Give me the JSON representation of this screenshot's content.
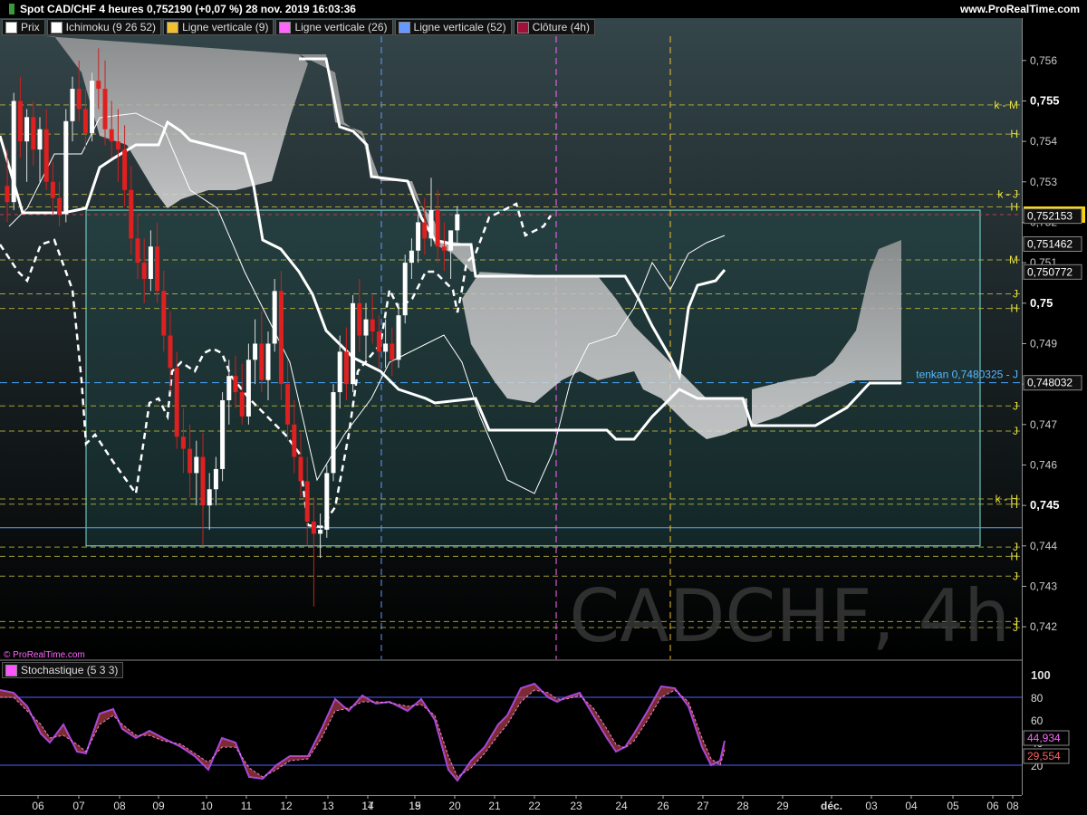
{
  "header": {
    "title": "Spot CAD/CHF 4 heures 0,752190 (+0,07 %) 28 nov. 2019 16:03:36",
    "brand": "www.ProRealTime.com",
    "small_brand": "© ProRealTime.com"
  },
  "legend": [
    {
      "label": "Prix",
      "color": "#ffffff"
    },
    {
      "label": "Ichimoku (9 26 52)",
      "color": "#ffffff"
    },
    {
      "label": "Ligne verticale (9)",
      "color": "#f0c030"
    },
    {
      "label": "Ligne verticale (26)",
      "color": "#ff66ff"
    },
    {
      "label": "Ligne verticale (52)",
      "color": "#6699ff"
    },
    {
      "label": "Clôture (4h)",
      "color": "#a0103a"
    }
  ],
  "watermark": "CADCHF, 4h",
  "price_axis": {
    "ticks": [
      "0,756",
      "0,755",
      "0,754",
      "0,753",
      "0,752",
      "0,751",
      "0,75",
      "0,749",
      "0,748",
      "0,747",
      "0,746",
      "0,745",
      "0,744",
      "0,743",
      "0,742"
    ],
    "bold_ticks": [
      "0,755",
      "0,75",
      "0,745"
    ],
    "current_price": "0,752190",
    "price_labels": [
      "0,752153",
      "0,751462",
      "0,750772",
      "0,748032"
    ]
  },
  "level_labels": [
    {
      "text": "k - M",
      "y": 0.7549
    },
    {
      "text": "H",
      "y": 0.75418
    },
    {
      "text": "k - J",
      "y": 0.75269
    },
    {
      "text": "H",
      "y": 0.75238
    },
    {
      "text": "M",
      "y": 0.75107
    },
    {
      "text": "J",
      "y": 0.75023
    },
    {
      "text": "H",
      "y": 0.74987
    },
    {
      "text": "J",
      "y": 0.74746
    },
    {
      "text": "J",
      "y": 0.74684
    },
    {
      "text": "k - H",
      "y": 0.74516
    },
    {
      "text": "H",
      "y": 0.74503
    },
    {
      "text": "J",
      "y": 0.74397
    },
    {
      "text": "H",
      "y": 0.74374
    },
    {
      "text": "J",
      "y": 0.74325
    },
    {
      "text": "J",
      "y": 0.74213
    },
    {
      "text": "J",
      "y": 0.74198
    }
  ],
  "tenkan_label": "tenkan  0,7480325 - J",
  "date_axis": [
    "06",
    "07",
    "08",
    "09",
    "10",
    "11",
    "12",
    "13",
    "14",
    "15",
    "17",
    "19",
    "20",
    "21",
    "22",
    "23",
    "24",
    "26",
    "27",
    "28",
    "29",
    "déc.",
    "03",
    "04",
    "05",
    "06",
    "08"
  ],
  "stochastic": {
    "label": "Stochastique (5 3 3)",
    "ticks": [
      "100",
      "80",
      "60",
      "40",
      "20"
    ],
    "k_value": "44,934",
    "d_value": "29,554"
  },
  "chart_data": {
    "type": "candlestick",
    "symbol": "CADCHF",
    "timeframe": "4h",
    "ylim": [
      0.7416,
      0.7566
    ],
    "last_close": 0.75219,
    "tenkan": 0.7480325,
    "candles": [
      [
        0.7529,
        0.7538,
        0.752,
        0.7525
      ],
      [
        0.7525,
        0.7552,
        0.7523,
        0.755
      ],
      [
        0.755,
        0.7556,
        0.7536,
        0.754
      ],
      [
        0.754,
        0.7548,
        0.753,
        0.7546
      ],
      [
        0.7546,
        0.755,
        0.7534,
        0.7538
      ],
      [
        0.7538,
        0.7546,
        0.753,
        0.7543
      ],
      [
        0.7543,
        0.7548,
        0.7528,
        0.753
      ],
      [
        0.753,
        0.7535,
        0.7522,
        0.7526
      ],
      [
        0.7526,
        0.753,
        0.7519,
        0.7522
      ],
      [
        0.7522,
        0.7548,
        0.752,
        0.7545
      ],
      [
        0.7545,
        0.7556,
        0.754,
        0.7553
      ],
      [
        0.7553,
        0.756,
        0.7545,
        0.7548
      ],
      [
        0.7548,
        0.7553,
        0.7538,
        0.7542
      ],
      [
        0.7542,
        0.7557,
        0.754,
        0.7555
      ],
      [
        0.7555,
        0.7563,
        0.7548,
        0.7553
      ],
      [
        0.7553,
        0.756,
        0.7539,
        0.7543
      ],
      [
        0.7543,
        0.755,
        0.7536,
        0.754
      ],
      [
        0.754,
        0.7548,
        0.753,
        0.7538
      ],
      [
        0.7538,
        0.7544,
        0.7524,
        0.7528
      ],
      [
        0.7528,
        0.7534,
        0.7512,
        0.7516
      ],
      [
        0.7516,
        0.7522,
        0.7506,
        0.751
      ],
      [
        0.751,
        0.7516,
        0.75,
        0.7506
      ],
      [
        0.7506,
        0.7518,
        0.7503,
        0.7514
      ],
      [
        0.7514,
        0.752,
        0.75,
        0.7503
      ],
      [
        0.7503,
        0.7508,
        0.7488,
        0.7492
      ],
      [
        0.7492,
        0.7498,
        0.7478,
        0.7484
      ],
      [
        0.7484,
        0.7488,
        0.7464,
        0.7467
      ],
      [
        0.7467,
        0.7474,
        0.7458,
        0.7464
      ],
      [
        0.7464,
        0.747,
        0.7452,
        0.7458
      ],
      [
        0.7458,
        0.7466,
        0.745,
        0.7462
      ],
      [
        0.7462,
        0.7468,
        0.744,
        0.745
      ],
      [
        0.745,
        0.7458,
        0.7444,
        0.7454
      ],
      [
        0.7454,
        0.7462,
        0.745,
        0.7459
      ],
      [
        0.7459,
        0.7478,
        0.7456,
        0.7476
      ],
      [
        0.7476,
        0.7486,
        0.747,
        0.7482
      ],
      [
        0.7482,
        0.7487,
        0.7474,
        0.7478
      ],
      [
        0.7478,
        0.7485,
        0.747,
        0.7472
      ],
      [
        0.7472,
        0.749,
        0.747,
        0.7486
      ],
      [
        0.7486,
        0.7496,
        0.748,
        0.749
      ],
      [
        0.749,
        0.7498,
        0.7478,
        0.7481
      ],
      [
        0.7481,
        0.7493,
        0.7476,
        0.749
      ],
      [
        0.749,
        0.7506,
        0.7488,
        0.7503
      ],
      [
        0.7503,
        0.7508,
        0.7476,
        0.748
      ],
      [
        0.748,
        0.7486,
        0.7466,
        0.747
      ],
      [
        0.747,
        0.7476,
        0.7458,
        0.7462
      ],
      [
        0.7462,
        0.7468,
        0.7452,
        0.7456
      ],
      [
        0.7456,
        0.7462,
        0.744,
        0.7446
      ],
      [
        0.7446,
        0.7452,
        0.7425,
        0.7443
      ],
      [
        0.7443,
        0.7448,
        0.7437,
        0.7444
      ],
      [
        0.7444,
        0.746,
        0.7442,
        0.7458
      ],
      [
        0.7458,
        0.748,
        0.7456,
        0.7478
      ],
      [
        0.7478,
        0.7492,
        0.7474,
        0.7488
      ],
      [
        0.7488,
        0.7494,
        0.7476,
        0.748
      ],
      [
        0.748,
        0.7502,
        0.7478,
        0.75
      ],
      [
        0.75,
        0.7506,
        0.7488,
        0.7492
      ],
      [
        0.7492,
        0.75,
        0.7486,
        0.7496
      ],
      [
        0.7496,
        0.7502,
        0.749,
        0.7493
      ],
      [
        0.7493,
        0.7497,
        0.7484,
        0.7488
      ],
      [
        0.7488,
        0.7496,
        0.7484,
        0.749
      ],
      [
        0.749,
        0.7494,
        0.7482,
        0.7486
      ],
      [
        0.7486,
        0.75,
        0.7484,
        0.7497
      ],
      [
        0.7497,
        0.7512,
        0.7495,
        0.751
      ],
      [
        0.751,
        0.7516,
        0.7506,
        0.7513
      ],
      [
        0.7513,
        0.7522,
        0.751,
        0.752
      ],
      [
        0.752,
        0.7526,
        0.7512,
        0.7516
      ],
      [
        0.7516,
        0.7531,
        0.7514,
        0.7523
      ],
      [
        0.7523,
        0.7528,
        0.751,
        0.7514
      ],
      [
        0.7514,
        0.752,
        0.7508,
        0.7513
      ],
      [
        0.7513,
        0.7518,
        0.7506,
        0.7518
      ],
      [
        0.7518,
        0.7524,
        0.7515,
        0.7522
      ]
    ]
  }
}
